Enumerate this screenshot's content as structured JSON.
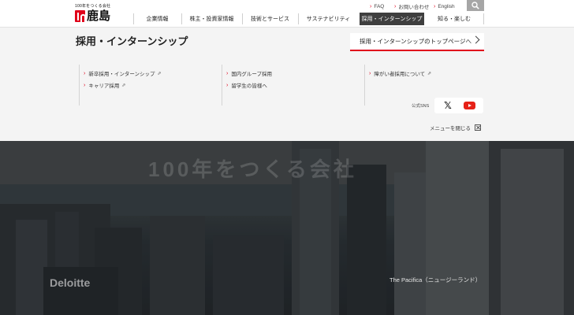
{
  "brand": {
    "tagline": "100年をつくる会社",
    "name": "鹿島",
    "accent_color": "#e0001b"
  },
  "utility_nav": [
    {
      "label": "FAQ",
      "icon": "chevron-right-icon"
    },
    {
      "label": "お問い合わせ",
      "icon": "chevron-right-icon"
    },
    {
      "label": "English",
      "icon": "chevron-right-icon"
    }
  ],
  "search": {
    "icon": "search-icon"
  },
  "global_nav": [
    {
      "label": "企業情報"
    },
    {
      "label": "株主・投資家情報"
    },
    {
      "label": "技術とサービス"
    },
    {
      "label": "サステナビリティ"
    },
    {
      "label": "採用・インターンシップ",
      "active": true
    },
    {
      "label": "知る・楽しむ"
    }
  ],
  "menu": {
    "title": "採用・インターンシップ",
    "top_link": "採用・インターンシップのトップページへ",
    "links": [
      {
        "label": "新卒採用・インターンシップ",
        "external": true
      },
      {
        "label": "キャリア採用",
        "external": true
      },
      {
        "label": "国内グループ採用",
        "external": false
      },
      {
        "label": "留学生の皆様へ",
        "external": false
      },
      {
        "label": "障がい者採用について",
        "external": true
      }
    ],
    "external_mark": "⇗",
    "sns_label": "公式SNS",
    "sns": [
      {
        "icon": "x-logo-icon"
      },
      {
        "icon": "youtube-icon"
      }
    ],
    "x_glyph": "𝕏",
    "close_label": "メニューを閉じる"
  },
  "hero": {
    "catchphrase": "100年をつくる会社",
    "caption": "The Pacifica（ニュージーランド）",
    "building_sign": "Deloitte"
  }
}
